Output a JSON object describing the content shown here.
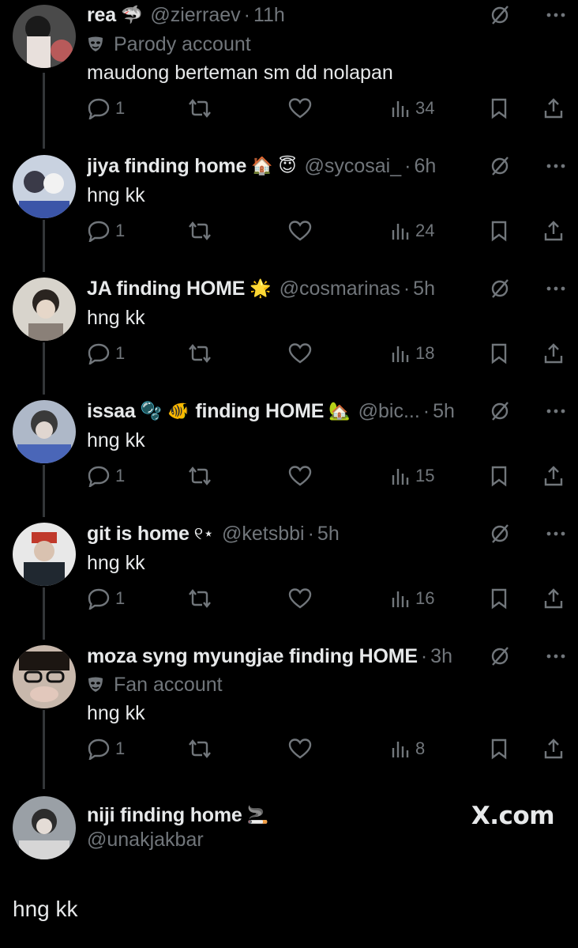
{
  "colors": {
    "background": "#000000",
    "text": "#e7e9ea",
    "muted": "#71767b",
    "line": "#333639"
  },
  "posts": [
    {
      "name": "rea",
      "name_emoji": "🦈",
      "handle": "@zierraev",
      "sep": "·",
      "time": "11h",
      "label": "Parody account",
      "text": "maudong berteman sm dd nolapan",
      "replies": "1",
      "views": "34"
    },
    {
      "name": "jiya finding home",
      "name_emoji": "🏠 😇",
      "handle": "@sycosai_",
      "sep": "·",
      "time": "6h",
      "text": "hng kk",
      "replies": "1",
      "views": "24"
    },
    {
      "name": "JA finding HOME",
      "name_emoji": "🌟",
      "handle": "@cosmarinas",
      "sep": "·",
      "time": "5h",
      "text": "hng kk",
      "replies": "1",
      "views": "18"
    },
    {
      "name": "issaa",
      "name_emoji": "🫧 🐠",
      "name2": "finding HOME",
      "name2_emoji": "🏡",
      "handle": "@bic...",
      "sep": "·",
      "time": "5h",
      "text": "hng kk",
      "replies": "1",
      "views": "15"
    },
    {
      "name": "git is home",
      "name_emoji": "୧⋆",
      "handle": "@ketsbbi",
      "sep": "·",
      "time": "5h",
      "text": "hng kk",
      "replies": "1",
      "views": "16"
    },
    {
      "name": "moza syng myungjae finding HOME",
      "sep": "·",
      "time": "3h",
      "label": "Fan account",
      "text": "hng kk",
      "replies": "1",
      "views": "8"
    },
    {
      "name": "niji finding home",
      "name_emoji": "🚬",
      "handle": "@unakjakbar",
      "text": "hng kk"
    }
  ],
  "watermark": "X.com",
  "icons": [
    "grok-icon",
    "more-icon",
    "reply-icon",
    "repost-icon",
    "like-icon",
    "views-icon",
    "bookmark-icon",
    "share-icon",
    "mask-icon"
  ]
}
